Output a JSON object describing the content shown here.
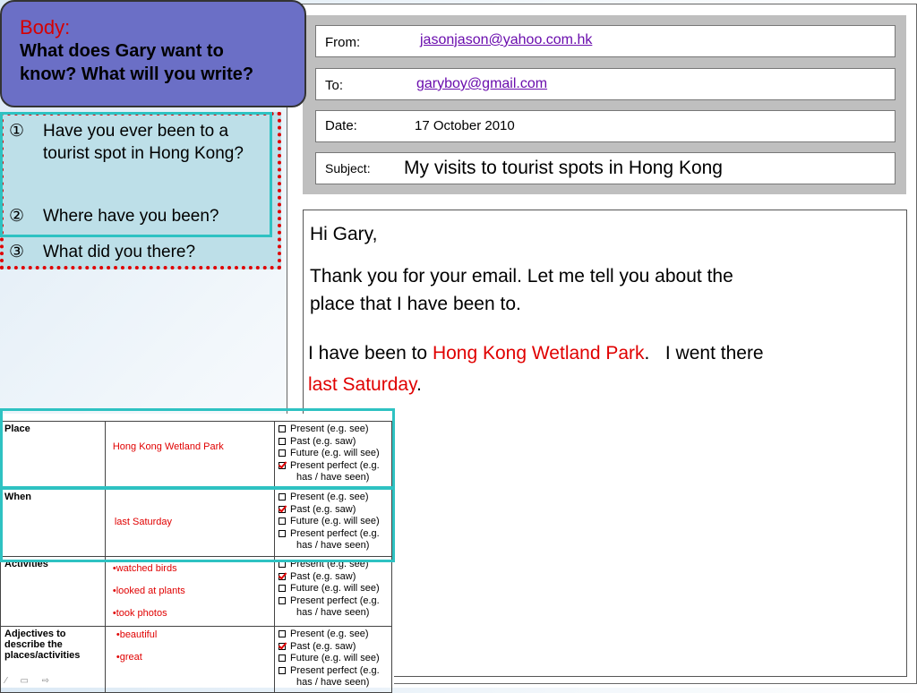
{
  "body_box": {
    "label": "Body:",
    "question_line1": "What does Gary want to",
    "question_line2": "know? What will you write?"
  },
  "questions": [
    {
      "num": "①",
      "text": "Have you ever been to a tourist spot in Hong Kong?"
    },
    {
      "num": "②",
      "text": "Where have you been?"
    },
    {
      "num": "③",
      "text": "What did you there?"
    }
  ],
  "email": {
    "from_label": "From:",
    "from_value": "jasonjason@yahoo.com.hk",
    "to_label": "To:",
    "to_value": "garyboy@gmail.com",
    "date_label": "Date:",
    "date_value": "17 October 2010",
    "subject_label": "Subject:",
    "subject_value": "My visits to tourist spots in Hong Kong",
    "greeting": "Hi Gary,",
    "para1_line1": "Thank you for your email. Let me tell you about the",
    "para1_line2": "place that I have been to.",
    "para2_a": "I have been to ",
    "para2_place": "Hong Kong Wetland Park",
    "para2_b": ".   I went there",
    "para2_time": "last Saturday",
    "para2_end": "."
  },
  "table": {
    "rows": [
      {
        "label": "Place",
        "content": [
          "Hong Kong Wetland Park"
        ],
        "options": [
          {
            "text": "Present (e.g. see)",
            "checked": false
          },
          {
            "text": "Past (e.g. saw)",
            "checked": false
          },
          {
            "text": "Future (e.g. will see)",
            "checked": false
          },
          {
            "text": "Present perfect (e.g.",
            "checked": true
          },
          {
            "text": "has / have seen)",
            "cont": true
          }
        ]
      },
      {
        "label": "When",
        "content": [
          "last Saturday"
        ],
        "options": [
          {
            "text": "Present (e.g. see)",
            "checked": false
          },
          {
            "text": "Past (e.g. saw)",
            "checked": true
          },
          {
            "text": "Future (e.g. will see)",
            "checked": false
          },
          {
            "text": "Present perfect (e.g.",
            "checked": false
          },
          {
            "text": "has / have seen)",
            "cont": true
          }
        ]
      },
      {
        "label": "Activities",
        "content": [
          "•watched birds",
          "•looked at plants",
          "•took photos"
        ],
        "options": [
          {
            "text": "Present (e.g. see)",
            "checked": false
          },
          {
            "text": "Past (e.g. saw)",
            "checked": true
          },
          {
            "text": "Future (e.g. will see)",
            "checked": false
          },
          {
            "text": "Present perfect (e.g.",
            "checked": false
          },
          {
            "text": "has / have seen)",
            "cont": true
          }
        ]
      },
      {
        "label": "Adjectives to describe the places/activities",
        "content": [
          "•beautiful",
          "•great"
        ],
        "options": [
          {
            "text": "Present (e.g. see)",
            "checked": false
          },
          {
            "text": "Past (e.g. saw)",
            "checked": true
          },
          {
            "text": "Future (e.g. will see)",
            "checked": false
          },
          {
            "text": "Present perfect (e.g.",
            "checked": false
          },
          {
            "text": "has / have seen)",
            "cont": true
          }
        ]
      }
    ]
  },
  "colors": {
    "accent_red": "#e00000",
    "highlight_teal": "#2ec2c2",
    "body_box_fill": "#6b6fc6",
    "link_purple": "#6a0dad"
  }
}
